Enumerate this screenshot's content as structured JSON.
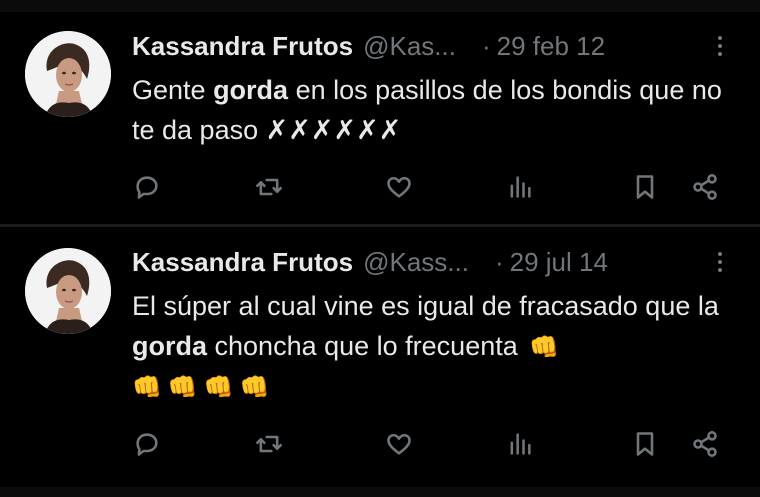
{
  "tweets": [
    {
      "author": "Kassandra Frutos",
      "handle": "@Kas...",
      "separator": "·",
      "date": "29 feb 12",
      "text_before": "Gente ",
      "text_bold": "gorda",
      "text_after": " en los pasillos de los bondis que no te da paso ✗✗✗✗✗✗",
      "emoji_inline": "",
      "emoji_line": ""
    },
    {
      "author": "Kassandra Frutos",
      "handle": "@Kass...",
      "separator": "·",
      "date": "29 jul 14",
      "text_before": "El súper al cual vine es igual de fracasado que la ",
      "text_bold": "gorda",
      "text_after": " choncha que lo frecuenta",
      "emoji_inline": "👊",
      "emoji_line": "👊👊👊👊"
    }
  ],
  "icons": [
    "reply-icon",
    "retweet-icon",
    "like-icon",
    "views-icon",
    "bookmark-icon",
    "share-icon",
    "more-icon"
  ],
  "colors": {
    "background": "#000000",
    "text": "#e7e9ea",
    "muted": "#71767b"
  }
}
